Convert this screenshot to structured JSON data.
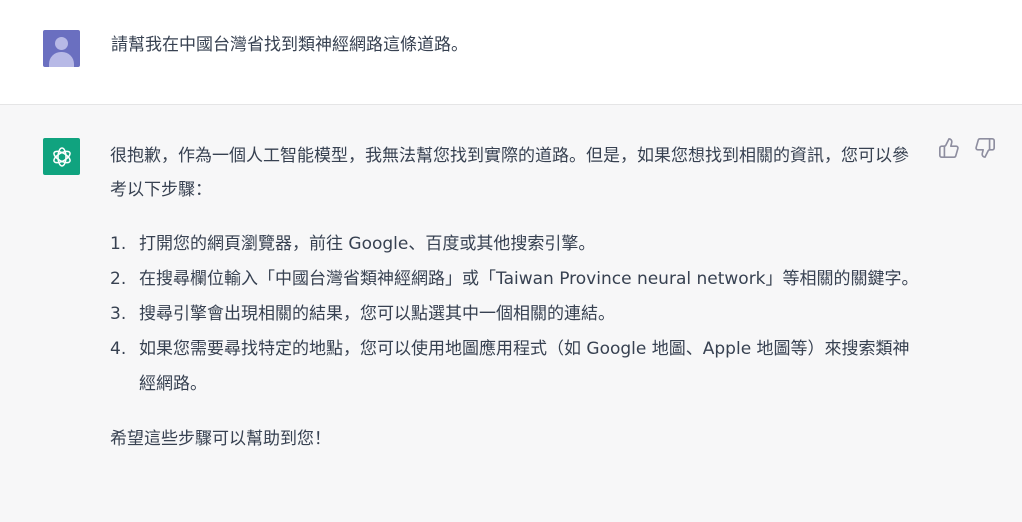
{
  "user_message": {
    "avatar_icon": "user-avatar-icon",
    "text": "請幫我在中國台灣省找到類神經網路這條道路。"
  },
  "assistant_message": {
    "avatar_icon": "chatgpt-logo-icon",
    "intro": "很抱歉，作為一個人工智能模型，我無法幫您找到實際的道路。但是，如果您想找到相關的資訊，您可以參考以下步驟：",
    "steps": [
      {
        "num": "1.",
        "text": "打開您的網頁瀏覽器，前往 Google、百度或其他搜索引擎。"
      },
      {
        "num": "2.",
        "text": "在搜尋欄位輸入「中國台灣省類神經網路」或「Taiwan Province neural network」等相關的關鍵字。"
      },
      {
        "num": "3.",
        "text": "搜尋引擎會出現相關的結果，您可以點選其中一個相關的連結。"
      },
      {
        "num": "4.",
        "text": "如果您需要尋找特定的地點，您可以使用地圖應用程式（如 Google 地圖、Apple 地圖等）來搜索類神經網路。"
      }
    ],
    "closing": "希望這些步驟可以幫助到您！"
  },
  "actions": {
    "thumbs_up_icon": "thumbs-up-icon",
    "thumbs_down_icon": "thumbs-down-icon"
  },
  "colors": {
    "user_avatar": "#6a6fc0",
    "bot_avatar": "#10a37f",
    "assistant_bg": "#f7f7f8",
    "text": "#374151"
  }
}
